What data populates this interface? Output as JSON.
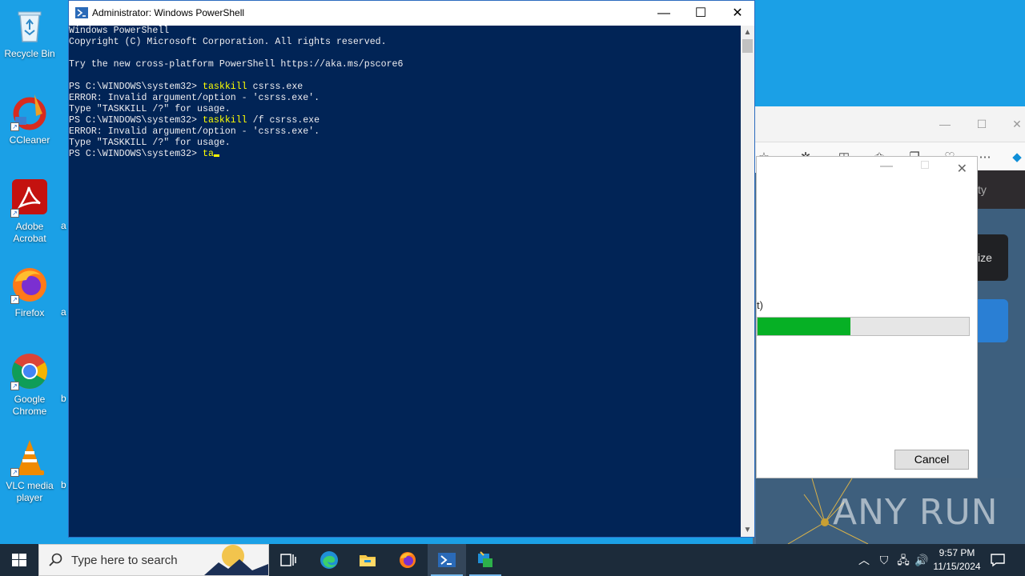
{
  "desktop": {
    "icons": [
      {
        "label_line1": "Recycle Bin",
        "label_line2": ""
      },
      {
        "label_line1": "CCleaner",
        "label_line2": ""
      },
      {
        "label_line1": "Adobe",
        "label_line2": "Acrobat"
      },
      {
        "label_line1": "Firefox",
        "label_line2": ""
      },
      {
        "label_line1": "Google",
        "label_line2": "Chrome"
      },
      {
        "label_line1": "VLC media",
        "label_line2": "player"
      }
    ],
    "cut_letters": [
      "a",
      "a",
      "b",
      "b"
    ]
  },
  "powershell": {
    "title": "Administrator: Windows PowerShell",
    "lines": [
      {
        "prefix": "Windows PowerShell",
        "cmd": "",
        "rest": ""
      },
      {
        "prefix": "Copyright (C) Microsoft Corporation. All rights reserved.",
        "cmd": "",
        "rest": ""
      },
      {
        "prefix": "",
        "cmd": "",
        "rest": ""
      },
      {
        "prefix": "Try the new cross-platform PowerShell https://aka.ms/pscore6",
        "cmd": "",
        "rest": ""
      },
      {
        "prefix": "",
        "cmd": "",
        "rest": ""
      },
      {
        "prefix": "PS C:\\WINDOWS\\system32> ",
        "cmd": "taskkill",
        "rest": " csrss.exe"
      },
      {
        "prefix": "ERROR: Invalid argument/option - 'csrss.exe'.",
        "cmd": "",
        "rest": ""
      },
      {
        "prefix": "Type \"TASKKILL /?\" for usage.",
        "cmd": "",
        "rest": ""
      },
      {
        "prefix": "PS C:\\WINDOWS\\system32> ",
        "cmd": "taskkill",
        "rest": " /f csrss.exe"
      },
      {
        "prefix": "ERROR: Invalid argument/option - 'csrss.exe'.",
        "cmd": "",
        "rest": ""
      },
      {
        "prefix": "Type \"TASKKILL /?\" for usage.",
        "cmd": "",
        "rest": ""
      },
      {
        "prefix": "PS C:\\WINDOWS\\system32> ",
        "cmd": "ta",
        "rest": ""
      }
    ]
  },
  "dialog": {
    "label": "t)",
    "progress_percent": 44,
    "cancel_label": "Cancel"
  },
  "edge": {
    "side_text_1": "ty",
    "side_text_2": "ize"
  },
  "watermark": "ANY RUN",
  "taskbar": {
    "search_placeholder": "Type here to search",
    "time": "9:57 PM",
    "date": "11/15/2024"
  },
  "colors": {
    "console_bg": "#012456",
    "console_text": "#eeedf0",
    "console_command": "#ffff00",
    "desktop_bg": "#1ba0e6",
    "progress_fill": "#06b025",
    "taskbar_bg": "#1c2b3a"
  },
  "icons": [
    "recycle-bin-icon",
    "ccleaner-icon",
    "acrobat-icon",
    "firefox-icon",
    "chrome-icon",
    "vlc-icon",
    "windows-start-icon",
    "search-icon",
    "task-view-icon",
    "edge-icon",
    "file-explorer-icon",
    "powershell-icon",
    "app-icon"
  ]
}
